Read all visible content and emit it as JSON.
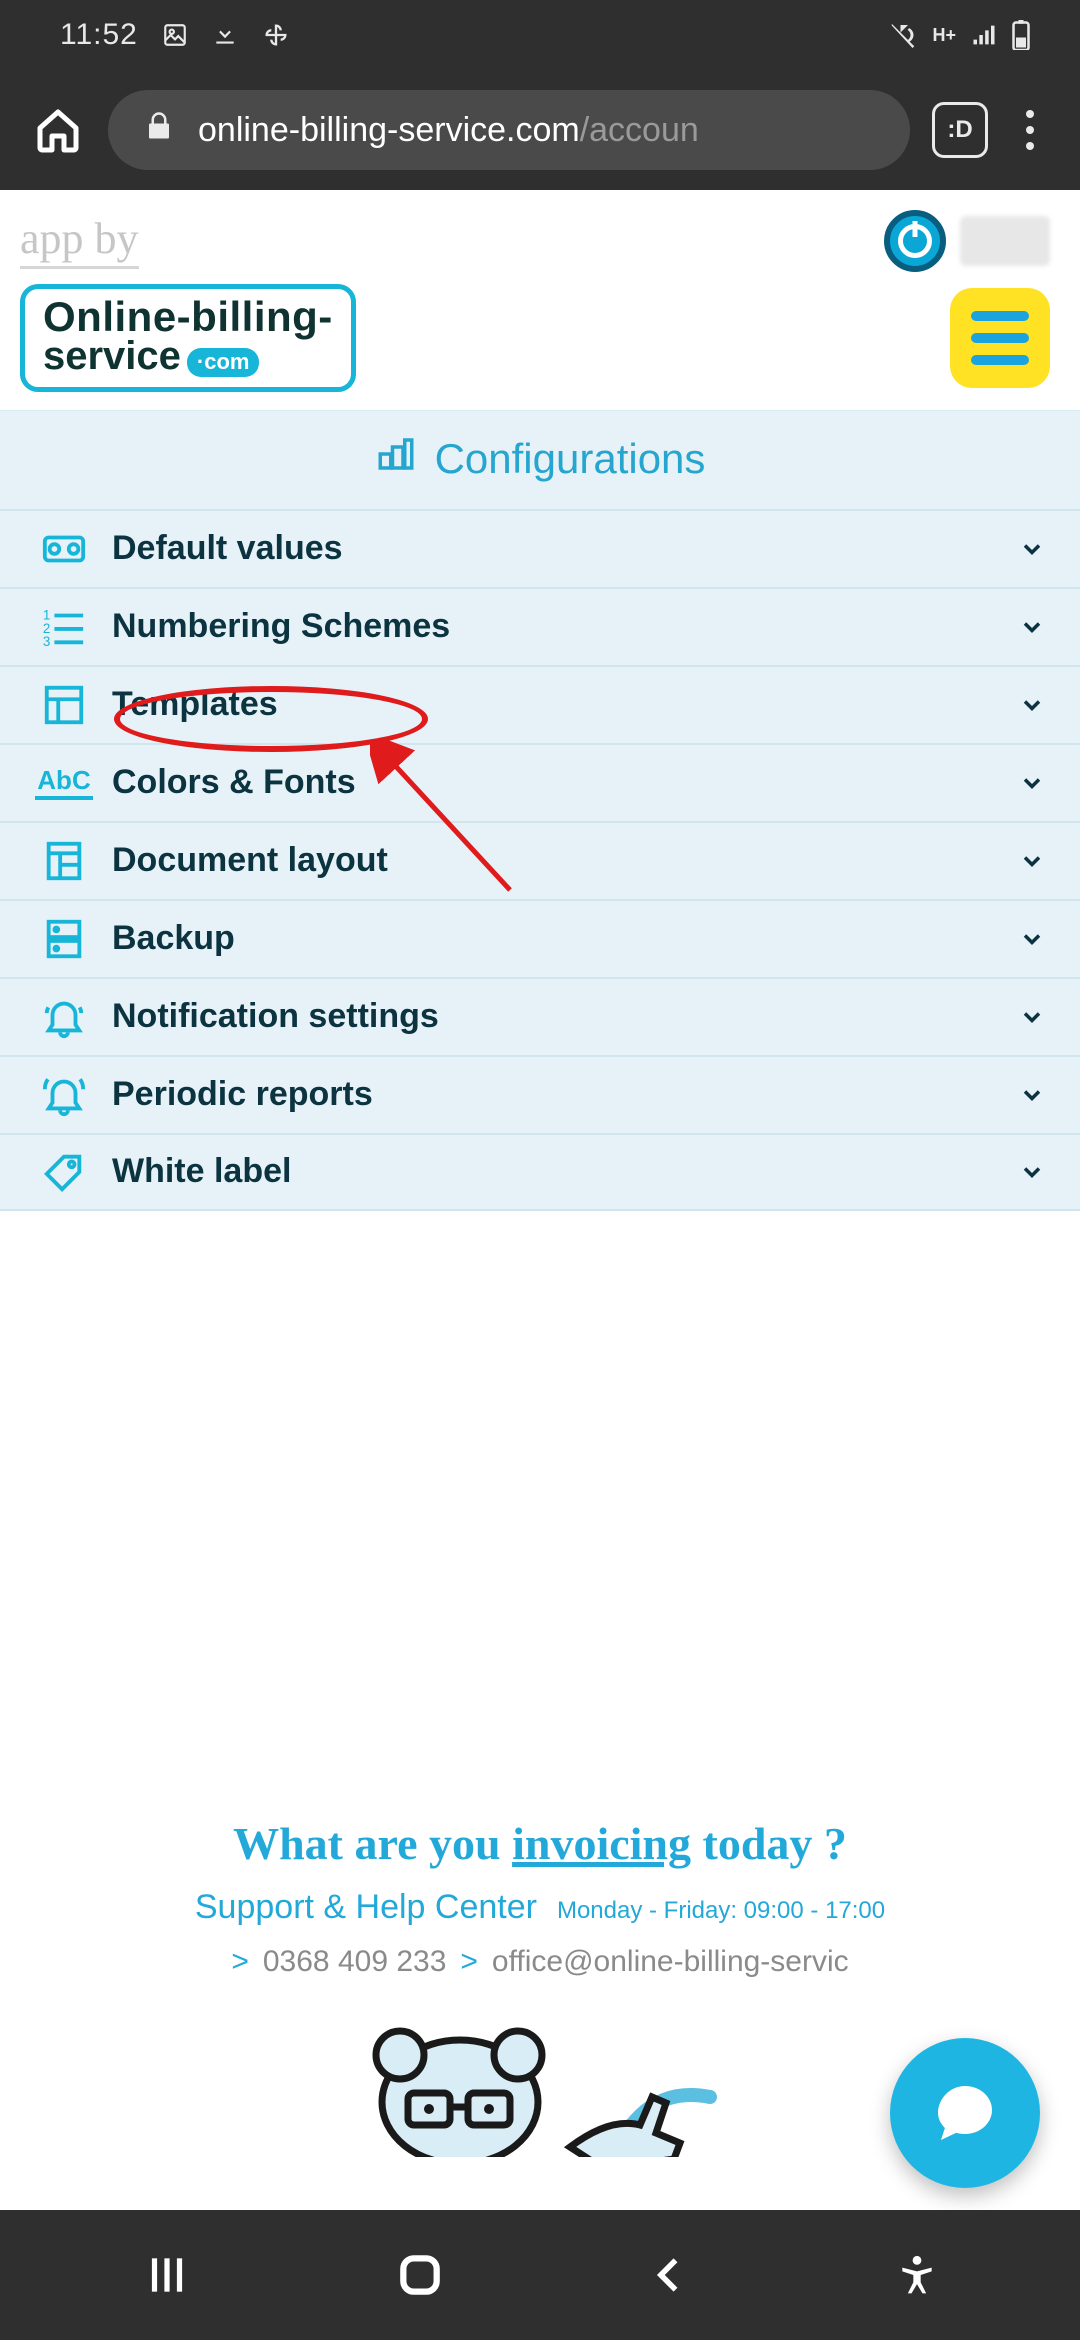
{
  "status": {
    "time": "11:52",
    "network_label": "H+"
  },
  "browser": {
    "url_host": "online-billing-service.com",
    "url_path": "/accoun",
    "tab_badge": ":D"
  },
  "header": {
    "app_by": "app by",
    "logo_line1": "Online-billing-",
    "logo_line2": "service",
    "logo_suffix": "·com"
  },
  "config": {
    "title": "Configurations",
    "items": [
      {
        "label": "Default values"
      },
      {
        "label": "Numbering Schemes"
      },
      {
        "label": "Templates"
      },
      {
        "label": "Colors & Fonts"
      },
      {
        "label": "Document layout"
      },
      {
        "label": "Backup"
      },
      {
        "label": "Notification settings"
      },
      {
        "label": "Periodic reports"
      },
      {
        "label": "White label"
      }
    ]
  },
  "footer": {
    "tagline_pre": "What are you ",
    "tagline_underlined": "invoicing",
    "tagline_post": " today ?",
    "support_title": "Support & Help Center",
    "support_hours": "Monday - Friday: 09:00 - 17:00",
    "phone": "0368 409 233",
    "email": "office@online-billing-servic",
    "gt": ">"
  },
  "colors": {
    "accent": "#17b5d8",
    "accent2": "#22a8d9",
    "yellow": "#ffe223",
    "panel": "#e6f2f8",
    "text_dark": "#0c3340",
    "annotation": "#df1b1b"
  }
}
